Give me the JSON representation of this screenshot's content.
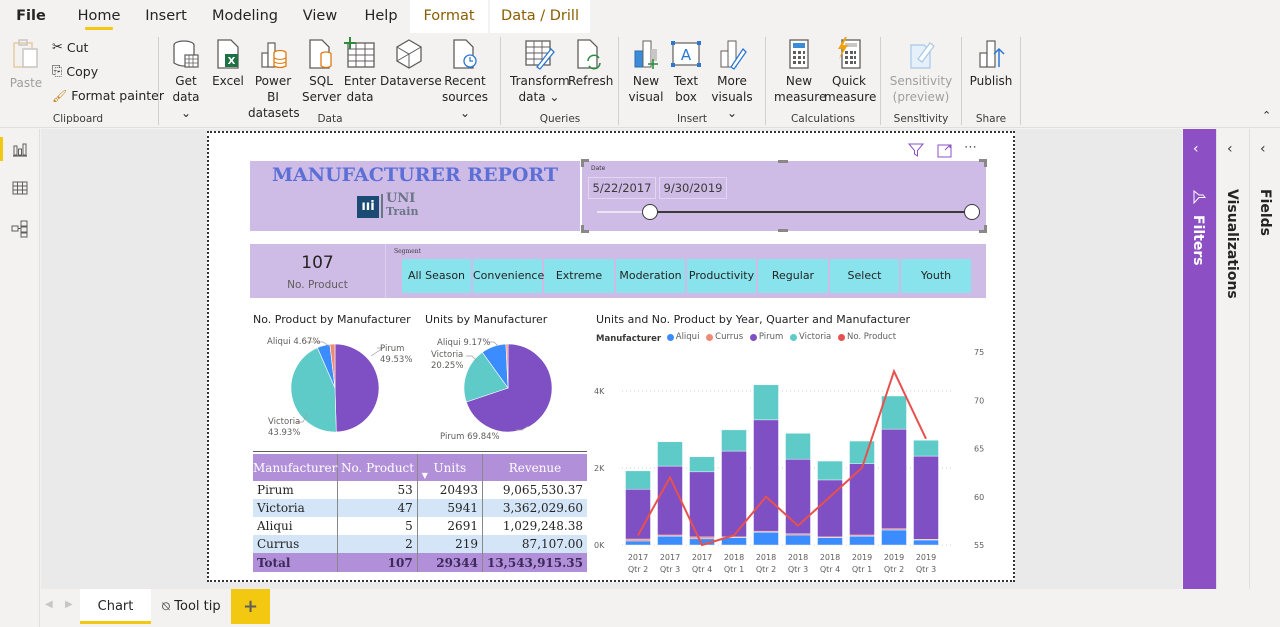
{
  "menu": {
    "tabs": [
      "File",
      "Home",
      "Insert",
      "Modeling",
      "View",
      "Help",
      "Format",
      "Data / Drill"
    ],
    "active": "Home"
  },
  "ribbon": {
    "clipboard": {
      "paste": "Paste",
      "cut": "Cut",
      "copy": "Copy",
      "format_painter": "Format painter",
      "label": "Clipboard"
    },
    "data": {
      "label": "Data",
      "buttons": [
        {
          "l1": "Get",
          "l2": "data ⌄"
        },
        {
          "l1": "Excel",
          "l2": ""
        },
        {
          "l1": "Power BI",
          "l2": "datasets"
        },
        {
          "l1": "SQL",
          "l2": "Server"
        },
        {
          "l1": "Enter",
          "l2": "data"
        },
        {
          "l1": "Dataverse",
          "l2": ""
        },
        {
          "l1": "Recent",
          "l2": "sources ⌄"
        }
      ]
    },
    "queries": {
      "label": "Queries",
      "transform_l1": "Transform",
      "transform_l2": "data ⌄",
      "refresh": "Refresh"
    },
    "insert": {
      "label": "Insert",
      "new_visual_l1": "New",
      "new_visual_l2": "visual",
      "text_box_l1": "Text",
      "text_box_l2": "box",
      "more_visuals_l1": "More",
      "more_visuals_l2": "visuals ⌄"
    },
    "calculations": {
      "label": "Calculations",
      "new_measure_l1": "New",
      "new_measure_l2": "measure",
      "quick_measure_l1": "Quick",
      "quick_measure_l2": "measure"
    },
    "sensitivity": {
      "label": "Sensitivity",
      "l1": "Sensitivity",
      "l2": "(preview) ⌄"
    },
    "share": {
      "label": "Share",
      "publish": "Publish"
    }
  },
  "report": {
    "title": "MANUFACTURER REPORT",
    "logo_mark": "ıııi",
    "logo_l1": "UNI",
    "logo_l2": "Train",
    "date_slicer": {
      "label": "Date",
      "start": "5/22/2017",
      "end": "9/30/2019",
      "start_fraction": 0.14,
      "end_fraction": 1.0
    },
    "kpi": {
      "value": "107",
      "label": "No. Product"
    },
    "segment": {
      "label": "Segment",
      "options": [
        "All Season",
        "Convenience",
        "Extreme",
        "Moderation",
        "Productivity",
        "Regular",
        "Select",
        "Youth"
      ]
    },
    "table": {
      "columns": [
        "Manufacturer",
        "No. Product",
        "Units",
        "Revenue"
      ],
      "rows": [
        [
          "Pirum",
          "53",
          "20493",
          "9,065,530.37"
        ],
        [
          "Victoria",
          "47",
          "5941",
          "3,362,029.60"
        ],
        [
          "Aliqui",
          "5",
          "2691",
          "1,029,248.38"
        ],
        [
          "Currus",
          "2",
          "219",
          "87,107.00"
        ]
      ],
      "total": [
        "Total",
        "107",
        "29344",
        "13,543,915.35"
      ]
    }
  },
  "colors": {
    "Aliqui": "#3b8cff",
    "Currus": "#f08a76",
    "Pirum": "#7f4fc4",
    "Victoria": "#5ecbc8",
    "No. Product": "#e8504e",
    "accent": "#8c50c4",
    "tab_accent": "#f2c811"
  },
  "chart_data": [
    {
      "type": "pie",
      "title": "No. Product by Manufacturer",
      "categories": [
        "Pirum",
        "Victoria",
        "Aliqui",
        "Currus"
      ],
      "values": [
        53,
        47,
        5,
        2
      ],
      "labels": [
        {
          "name": "Pirum",
          "pct": "49.53%"
        },
        {
          "name": "Victoria",
          "pct": "43.93%"
        },
        {
          "name": "Aliqui",
          "pct": "4.67%"
        }
      ]
    },
    {
      "type": "pie",
      "title": "Units by Manufacturer",
      "categories": [
        "Pirum",
        "Victoria",
        "Aliqui",
        "Currus"
      ],
      "values": [
        20493,
        5941,
        2691,
        219
      ],
      "labels": [
        {
          "name": "Pirum",
          "pct": "69.84%"
        },
        {
          "name": "Victoria",
          "pct": "20.25%"
        },
        {
          "name": "Aliqui",
          "pct": "9.17%"
        }
      ]
    },
    {
      "type": "bar",
      "stacked": true,
      "title": "Units and No. Product by Year, Quarter and Manufacturer",
      "legend_title": "Manufacturer",
      "legend": [
        "Aliqui",
        "Currus",
        "Pirum",
        "Victoria",
        "No. Product"
      ],
      "categories": [
        [
          "2017",
          "Qtr 2"
        ],
        [
          "2017",
          "Qtr 3"
        ],
        [
          "2017",
          "Qtr 4"
        ],
        [
          "2018",
          "Qtr 1"
        ],
        [
          "2018",
          "Qtr 2"
        ],
        [
          "2018",
          "Qtr 3"
        ],
        [
          "2018",
          "Qtr 4"
        ],
        [
          "2019",
          "Qtr 1"
        ],
        [
          "2019",
          "Qtr 2"
        ],
        [
          "2019",
          "Qtr 3"
        ]
      ],
      "series": [
        {
          "name": "Aliqui",
          "values": [
            105,
            230,
            160,
            190,
            330,
            260,
            190,
            230,
            390,
            130
          ]
        },
        {
          "name": "Currus",
          "values": [
            50,
            30,
            50,
            20,
            30,
            30,
            20,
            30,
            30,
            20
          ]
        },
        {
          "name": "Pirum",
          "values": [
            1295,
            1790,
            1690,
            2230,
            2890,
            1940,
            1480,
            1850,
            2590,
            2160
          ]
        },
        {
          "name": "Victoria",
          "values": [
            475,
            630,
            390,
            550,
            910,
            670,
            490,
            590,
            860,
            410
          ]
        }
      ],
      "line": {
        "name": "No. Product",
        "values": [
          56,
          62,
          55,
          56,
          60,
          57,
          60,
          63,
          73,
          66
        ]
      },
      "y_left": {
        "ticks": [
          "0K",
          "2K",
          "4K"
        ],
        "range": [
          0,
          4500
        ]
      },
      "y_right": {
        "ticks": [
          "55",
          "60",
          "65",
          "70",
          "75"
        ],
        "range": [
          55,
          75
        ]
      },
      "grid": true,
      "legend_position": "top-left"
    }
  ],
  "right_panes": {
    "filters": "Filters",
    "visualizations": "Visualizations",
    "fields": "Fields"
  },
  "pages": {
    "tabs": [
      "Chart",
      "Tool tip"
    ],
    "active": "Chart",
    "add": "+"
  }
}
